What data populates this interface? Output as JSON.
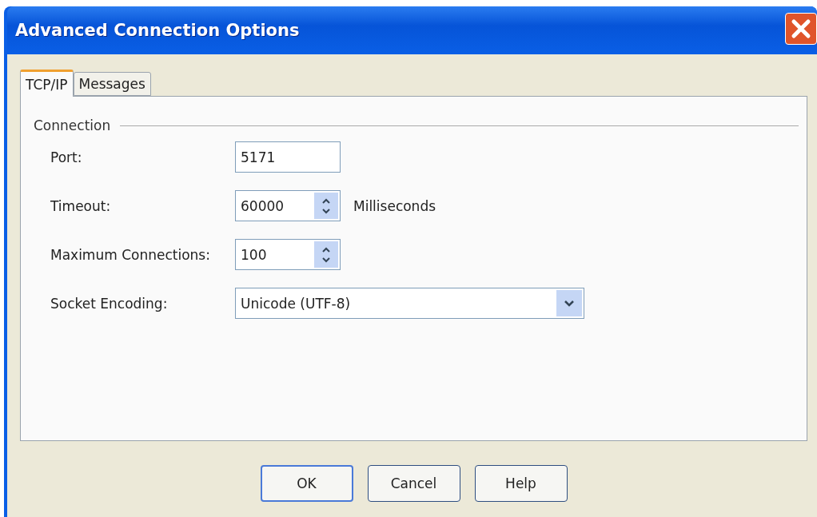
{
  "window": {
    "title": "Advanced Connection Options"
  },
  "tabs": [
    {
      "label": "TCP/IP",
      "selected": true
    },
    {
      "label": "Messages",
      "selected": false
    }
  ],
  "group": {
    "title": "Connection"
  },
  "fields": [
    {
      "kind": "text",
      "label": "Port:",
      "value": "5171"
    },
    {
      "kind": "spinner",
      "label": "Timeout:",
      "value": "60000",
      "unit": "Milliseconds"
    },
    {
      "kind": "spinner",
      "label": "Maximum Connections:",
      "value": "100"
    },
    {
      "kind": "select",
      "label": "Socket Encoding:",
      "value": "Unicode (UTF-8)"
    }
  ],
  "buttons": [
    {
      "label": "OK",
      "default": true
    },
    {
      "label": "Cancel",
      "default": false
    },
    {
      "label": "Help",
      "default": false
    }
  ]
}
